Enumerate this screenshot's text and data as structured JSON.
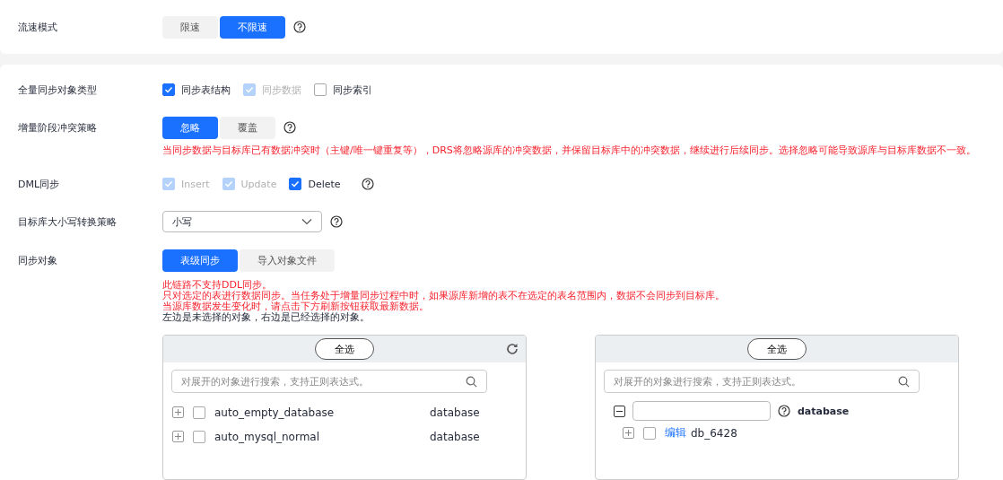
{
  "flow_mode": {
    "label": "流速模式",
    "options": [
      {
        "label": "限速",
        "selected": false
      },
      {
        "label": "不限速",
        "selected": true
      }
    ]
  },
  "full_sync_types": {
    "label": "全量同步对象类型",
    "options": [
      {
        "label": "同步表结构",
        "checked": true,
        "disabled": false
      },
      {
        "label": "同步数据",
        "checked": true,
        "disabled": true
      },
      {
        "label": "同步索引",
        "checked": false,
        "disabled": false
      }
    ]
  },
  "conflict_policy": {
    "label": "增量阶段冲突策略",
    "options": [
      {
        "label": "忽略",
        "selected": true
      },
      {
        "label": "覆盖",
        "selected": false
      }
    ],
    "warning": "当同步数据与目标库已有数据冲突时（主键/唯一键重复等），DRS将忽略源库的冲突数据，并保留目标库中的冲突数据，继续进行后续同步。选择忽略可能导致源库与目标库数据不一致。"
  },
  "dml_sync": {
    "label": "DML同步",
    "options": [
      {
        "label": "Insert",
        "checked": true,
        "disabled": true
      },
      {
        "label": "Update",
        "checked": true,
        "disabled": true
      },
      {
        "label": "Delete",
        "checked": true,
        "disabled": false
      }
    ]
  },
  "case_policy": {
    "label": "目标库大小写转换策略",
    "value": "小写"
  },
  "sync_objects": {
    "label": "同步对象",
    "options": [
      {
        "label": "表级同步",
        "selected": true
      },
      {
        "label": "导入对象文件",
        "selected": false
      }
    ],
    "notes": [
      {
        "text": "此链路不支持DDL同步。",
        "kind": "warning"
      },
      {
        "text": "只对选定的表进行数据同步。当任务处于增量同步过程中时，如果源库新增的表不在选定的表名范围内，数据不会同步到目标库。",
        "kind": "warning"
      },
      {
        "text": "当源库数据发生变化时，请点击下方刷新按钮获取最新数据。",
        "kind": "warning"
      },
      {
        "text": "左边是未选择的对象，右边是已经选择的对象。",
        "kind": "info"
      }
    ]
  },
  "left_panel": {
    "select_all": "全选",
    "search_placeholder": "对展开的对象进行搜索，支持正则表达式。",
    "rows": [
      {
        "name": "auto_empty_database",
        "type": "database",
        "checked": false
      },
      {
        "name": "auto_mysql_normal",
        "type": "database",
        "checked": false
      }
    ]
  },
  "right_panel": {
    "select_all": "全选",
    "search_placeholder": "对展开的对象进行搜索，支持正则表达式。",
    "group_type": "database",
    "items": [
      {
        "action": "编辑",
        "name": "db_6428",
        "checked": false
      }
    ]
  }
}
